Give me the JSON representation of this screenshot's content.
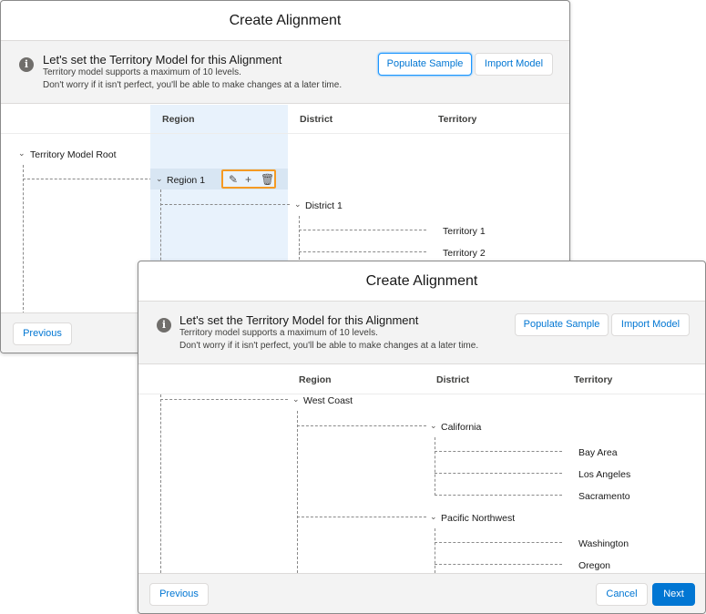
{
  "back": {
    "title": "Create Alignment",
    "banner": {
      "title": "Let's set the Territory Model for this Alignment",
      "line1": "Territory model supports a maximum of 10 levels.",
      "line2": "Don't worry if it isn't perfect, you'll be able to make changes at a later time.",
      "populate": "Populate Sample",
      "import": "Import Model"
    },
    "columns": [
      "Region",
      "District",
      "Territory"
    ],
    "tree": {
      "root": "Territory Model Root",
      "region": "Region 1",
      "district": "District 1",
      "territories": [
        "Territory 1",
        "Territory 2"
      ]
    },
    "footer": {
      "previous": "Previous"
    },
    "colors": {
      "highlight": "#f59a23",
      "region_column": "#e8f2fc"
    }
  },
  "front": {
    "title": "Create Alignment",
    "banner": {
      "title": "Let's set the Territory Model for this Alignment",
      "line1": "Territory model supports a maximum of 10 levels.",
      "line2": "Don't worry if it isn't perfect, you'll be able to make changes at a later time.",
      "populate": "Populate Sample",
      "import": "Import Model"
    },
    "columns": [
      "Region",
      "District",
      "Territory"
    ],
    "tree": {
      "region": "West Coast",
      "district1": "California",
      "territories1": [
        "Bay Area",
        "Los Angeles",
        "Sacramento"
      ],
      "district2": "Pacific Northwest",
      "territories2": [
        "Washington",
        "Oregon"
      ]
    },
    "footer": {
      "previous": "Previous",
      "cancel": "Cancel",
      "next": "Next"
    },
    "colors": {
      "brand": "#0176d3"
    }
  }
}
